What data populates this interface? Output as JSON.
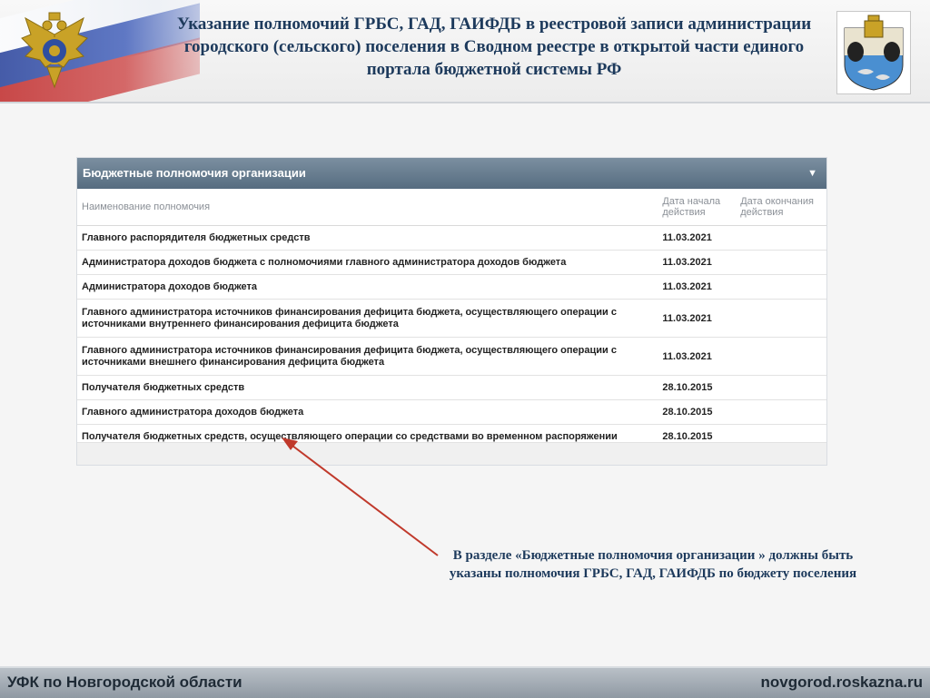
{
  "header": {
    "title": "Указание полномочий ГРБС, ГАД, ГАИФДБ в реестровой записи администрации городского (сельского) поселения в Сводном реестре в открытой части единого портала бюджетной системы РФ"
  },
  "panel": {
    "title": "Бюджетные полномочия организации",
    "toggle_icon": "▼",
    "columns": {
      "name": "Наименование полномочия",
      "start": "Дата начала действия",
      "end": "Дата окончания действия"
    },
    "rows": [
      {
        "name": "Главного распорядителя бюджетных средств",
        "start": "11.03.2021",
        "end": ""
      },
      {
        "name": "Администратора доходов бюджета с полномочиями главного администратора доходов бюджета",
        "start": "11.03.2021",
        "end": ""
      },
      {
        "name": "Администратора доходов бюджета",
        "start": "11.03.2021",
        "end": ""
      },
      {
        "name": "Главного администратора источников финансирования дефицита бюджета, осуществляющего операции с источниками внутреннего финансирования дефицита бюджета",
        "start": "11.03.2021",
        "end": ""
      },
      {
        "name": "Главного администратора источников финансирования дефицита бюджета, осуществляющего операции с источниками внешнего финансирования дефицита бюджета",
        "start": "11.03.2021",
        "end": ""
      },
      {
        "name": "Получателя бюджетных средств",
        "start": "28.10.2015",
        "end": ""
      },
      {
        "name": "Главного администратора доходов бюджета",
        "start": "28.10.2015",
        "end": ""
      },
      {
        "name": "Получателя бюджетных средств, осуществляющего операции со средствами во временном распоряжении",
        "start": "28.10.2015",
        "end": ""
      }
    ]
  },
  "annotation": {
    "text": "В разделе «Бюджетные полномочия организации » должны быть указаны полномочия ГРБС, ГАД, ГАИФДБ по бюджету поселения",
    "arrow_color": "#c0392b"
  },
  "footer": {
    "left": "УФК по Новгородской области",
    "right": "novgorod.roskazna.ru"
  },
  "colors": {
    "title": "#1d3a5c",
    "panel_header": "#566c80"
  }
}
